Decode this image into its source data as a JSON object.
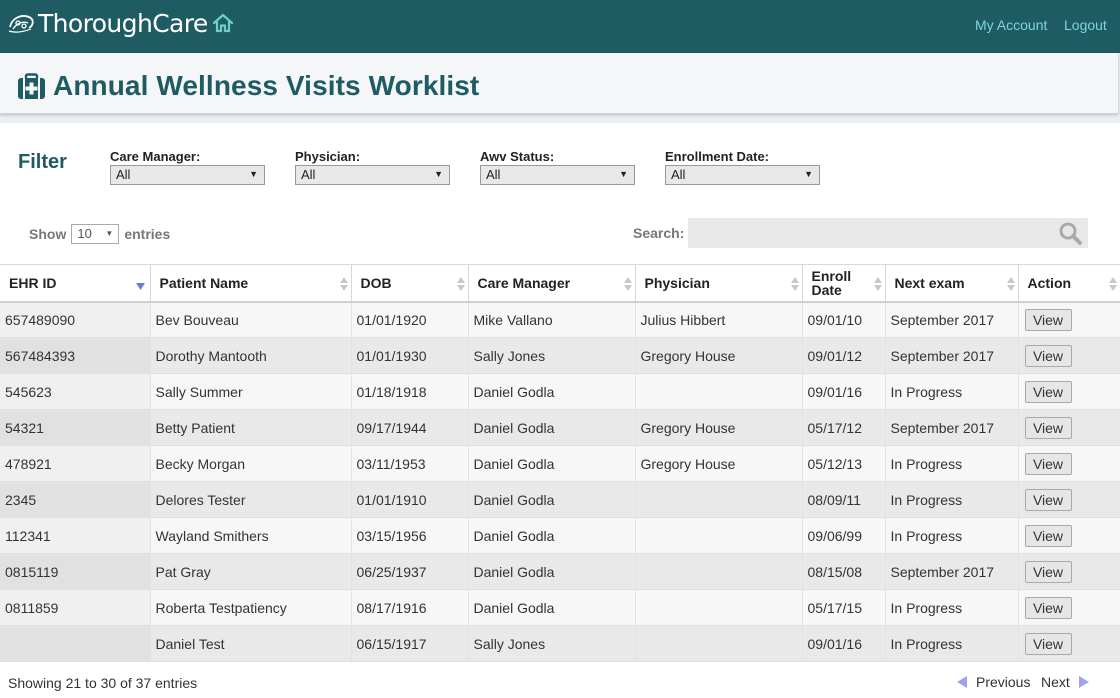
{
  "app": {
    "brand": "ThoroughCare",
    "nav": {
      "my_account": "My Account",
      "logout": "Logout"
    }
  },
  "page": {
    "title": "Annual Wellness Visits Worklist"
  },
  "filters": {
    "heading": "Filter",
    "care_manager": {
      "label": "Care Manager:",
      "value": "All"
    },
    "physician": {
      "label": "Physician:",
      "value": "All"
    },
    "awv_status": {
      "label": "Awv Status:",
      "value": "All"
    },
    "enrollment_date": {
      "label": "Enrollment Date:",
      "value": "All"
    }
  },
  "table_controls": {
    "show_label": "Show",
    "entries_label": "entries",
    "page_length": "10",
    "search_label": "Search:",
    "search_value": ""
  },
  "table": {
    "columns": [
      "EHR ID",
      "Patient Name",
      "DOB",
      "Care Manager",
      "Physician",
      "Enroll Date",
      "Next exam",
      "Action"
    ],
    "rows": [
      [
        "657489090",
        "Bev Bouveau",
        "01/01/1920",
        "Mike Vallano",
        "Julius Hibbert",
        "09/01/10",
        "September 2017",
        "View"
      ],
      [
        "567484393",
        "Dorothy Mantooth",
        "01/01/1930",
        "Sally Jones",
        "Gregory House",
        "09/01/12",
        "September 2017",
        "View"
      ],
      [
        "545623",
        "Sally Summer",
        "01/18/1918",
        "Daniel Godla",
        "",
        "09/01/16",
        "In Progress",
        "View"
      ],
      [
        "54321",
        "Betty Patient",
        "09/17/1944",
        "Daniel Godla",
        "Gregory House",
        "05/17/12",
        "September 2017",
        "View"
      ],
      [
        "478921",
        "Becky Morgan",
        "03/11/1953",
        "Daniel Godla",
        "Gregory House",
        "05/12/13",
        "In Progress",
        "View"
      ],
      [
        "2345",
        "Delores Tester",
        "01/01/1910",
        "Daniel Godla",
        "",
        "08/09/11",
        "In Progress",
        "View"
      ],
      [
        "112341",
        "Wayland Smithers",
        "03/15/1956",
        "Daniel Godla",
        "",
        "09/06/99",
        "In Progress",
        "View"
      ],
      [
        "0815119",
        "Pat Gray",
        "06/25/1937",
        "Daniel Godla",
        "",
        "08/15/08",
        "September 2017",
        "View"
      ],
      [
        "0811859",
        "Roberta Testpatiency",
        "08/17/1916",
        "Daniel Godla",
        "",
        "05/17/15",
        "In Progress",
        "View"
      ],
      [
        "",
        "Daniel Test",
        "06/15/1917",
        "Sally Jones",
        "",
        "09/01/16",
        "In Progress",
        "View"
      ]
    ]
  },
  "footer": {
    "info": "Showing 21 to 30 of 37 entries",
    "previous": "Previous",
    "next": "Next"
  },
  "colors": {
    "header_bg": "#1f5b63",
    "title_color": "#1f5b63",
    "link_color": "#7fd3de",
    "pager_arrow": "#9ea3ee"
  },
  "icons": {
    "home": "home-icon",
    "title": "medical-kit-icon",
    "search": "search-icon",
    "sort": "sort-icon",
    "previous": "triangle-left-icon",
    "next": "triangle-right-icon"
  }
}
